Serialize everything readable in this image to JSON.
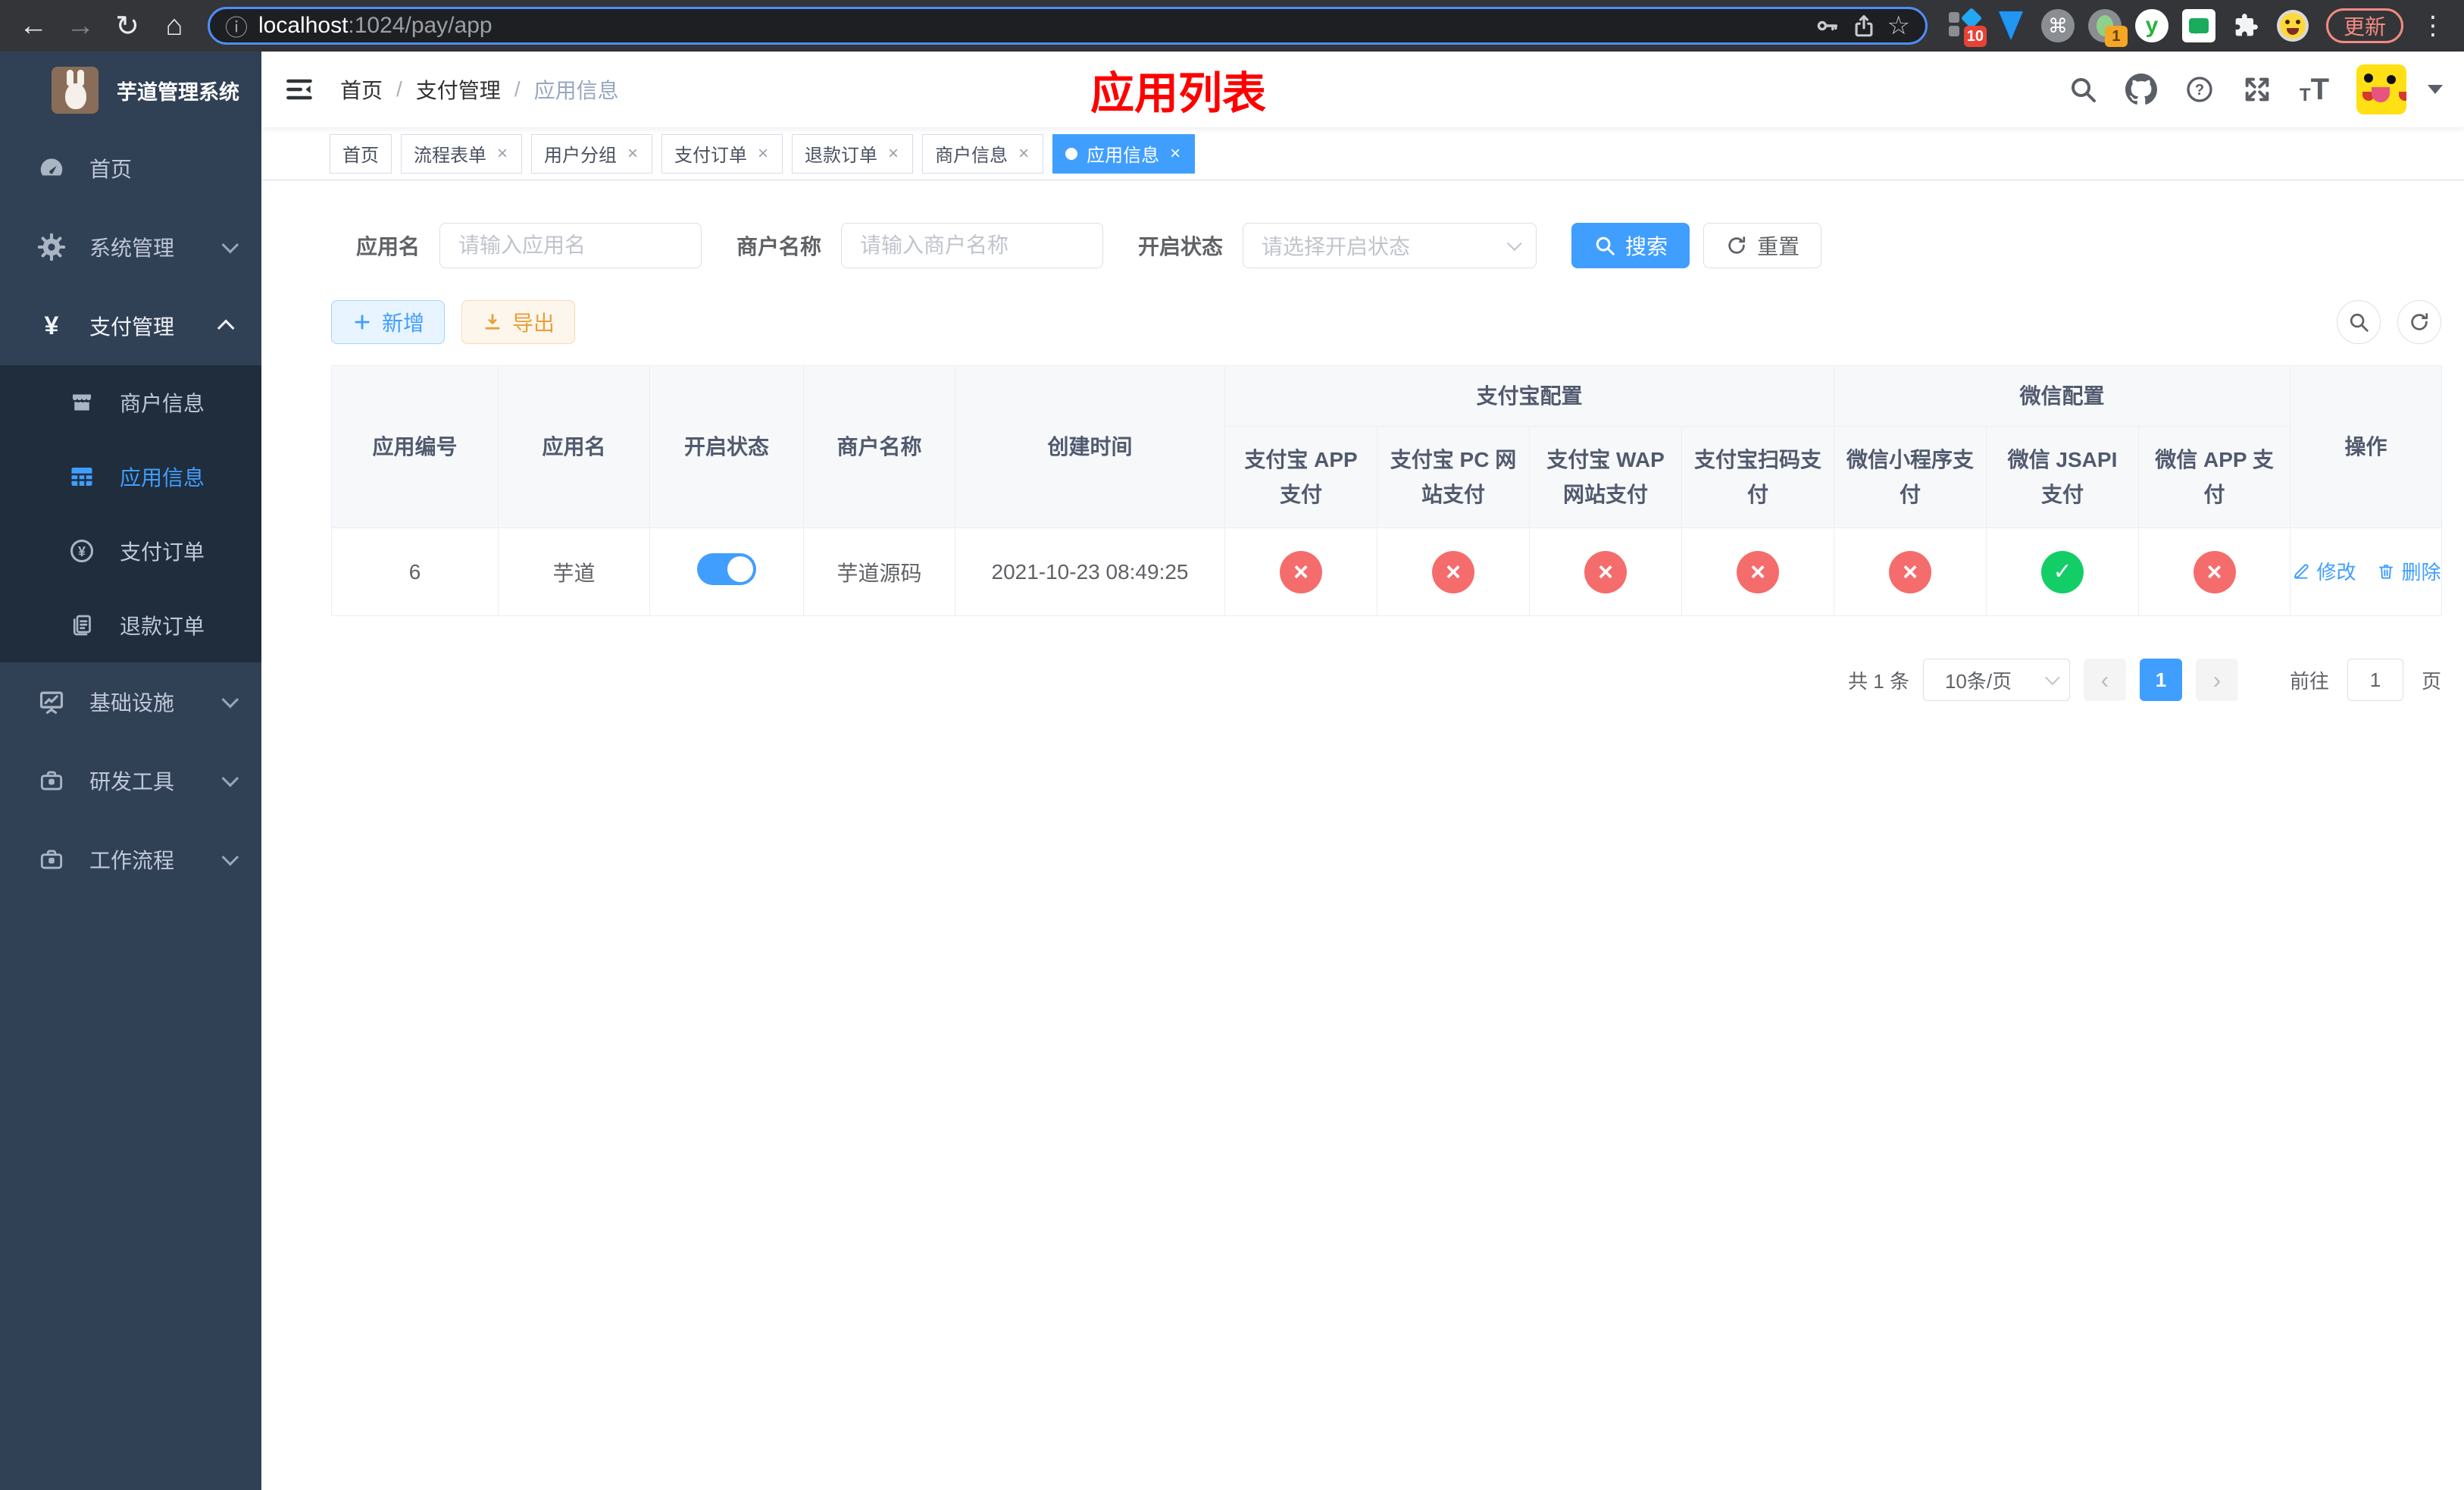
{
  "browser": {
    "url_host": "localhost",
    "url_rest": ":1024/pay/app",
    "update_label": "更新",
    "extension_badge_a": "10",
    "extension_badge_b": "1"
  },
  "glyphs": {
    "back": "←",
    "forward": "→",
    "reload": "↻",
    "home": "⌂",
    "info": "ⓘ",
    "star": "☆",
    "command": "⌘",
    "menu_dots": "⋮",
    "close": "×",
    "prev": "‹",
    "next": "›",
    "yen": "¥",
    "question": "?"
  },
  "sidebar": {
    "title": "芋道管理系统",
    "menu": [
      {
        "label": "首页"
      },
      {
        "label": "系统管理"
      },
      {
        "label": "支付管理"
      },
      {
        "label": "基础设施"
      },
      {
        "label": "研发工具"
      },
      {
        "label": "工作流程"
      }
    ],
    "submenu": [
      {
        "label": "商户信息"
      },
      {
        "label": "应用信息"
      },
      {
        "label": "支付订单"
      },
      {
        "label": "退款订单"
      }
    ]
  },
  "header": {
    "breadcrumb": {
      "home": "首页",
      "section": "支付管理",
      "current": "应用信息"
    },
    "page_title": "应用列表"
  },
  "tabs": [
    {
      "label": "首页"
    },
    {
      "label": "流程表单"
    },
    {
      "label": "用户分组"
    },
    {
      "label": "支付订单"
    },
    {
      "label": "退款订单"
    },
    {
      "label": "商户信息"
    },
    {
      "label": "应用信息"
    }
  ],
  "filters": {
    "app_name_label": "应用名",
    "app_name_placeholder": "请输入应用名",
    "merchant_label": "商户名称",
    "merchant_placeholder": "请输入商户名称",
    "status_label": "开启状态",
    "status_placeholder": "请选择开启状态",
    "search_label": "搜索",
    "reset_label": "重置"
  },
  "toolbar": {
    "add_label": "新增",
    "export_label": "导出"
  },
  "table": {
    "head": {
      "app_id": "应用编号",
      "app_name": "应用名",
      "status": "开启状态",
      "merchant": "商户名称",
      "created": "创建时间",
      "alipay_group": "支付宝配置",
      "wechat_group": "微信配置",
      "alipay_app": "支付宝 APP 支付",
      "alipay_pc": "支付宝 PC 网站支付",
      "alipay_wap": "支付宝 WAP 网站支付",
      "alipay_qr": "支付宝扫码支付",
      "wechat_lite": "微信小程序支付",
      "wechat_jsapi": "微信 JSAPI 支付",
      "wechat_app": "微信 APP 支付",
      "actions": "操作"
    },
    "row": {
      "app_id": "6",
      "app_name": "芋道",
      "status": "on",
      "merchant": "芋道源码",
      "created": "2021-10-23 08:49:25",
      "payments": {
        "alipay_app": "off",
        "alipay_pc": "off",
        "alipay_wap": "off",
        "alipay_qr": "off",
        "wechat_lite": "off",
        "wechat_jsapi": "on",
        "wechat_app": "off"
      },
      "edit_label": "修改",
      "delete_label": "删除"
    }
  },
  "pagination": {
    "total": "共 1 条",
    "page_size": "10条/页",
    "page": "1",
    "goto_label": "前往",
    "goto_value": "1",
    "unit_label": "页"
  },
  "colors": {
    "accent_blue": "#409eff",
    "danger_red": "#f56c6c",
    "success_green": "#13ce66",
    "warning_orange": "#e6a23c",
    "title_red": "#ff0000",
    "sidebar_bg": "#304156",
    "submenu_bg": "#1f2d3d"
  }
}
